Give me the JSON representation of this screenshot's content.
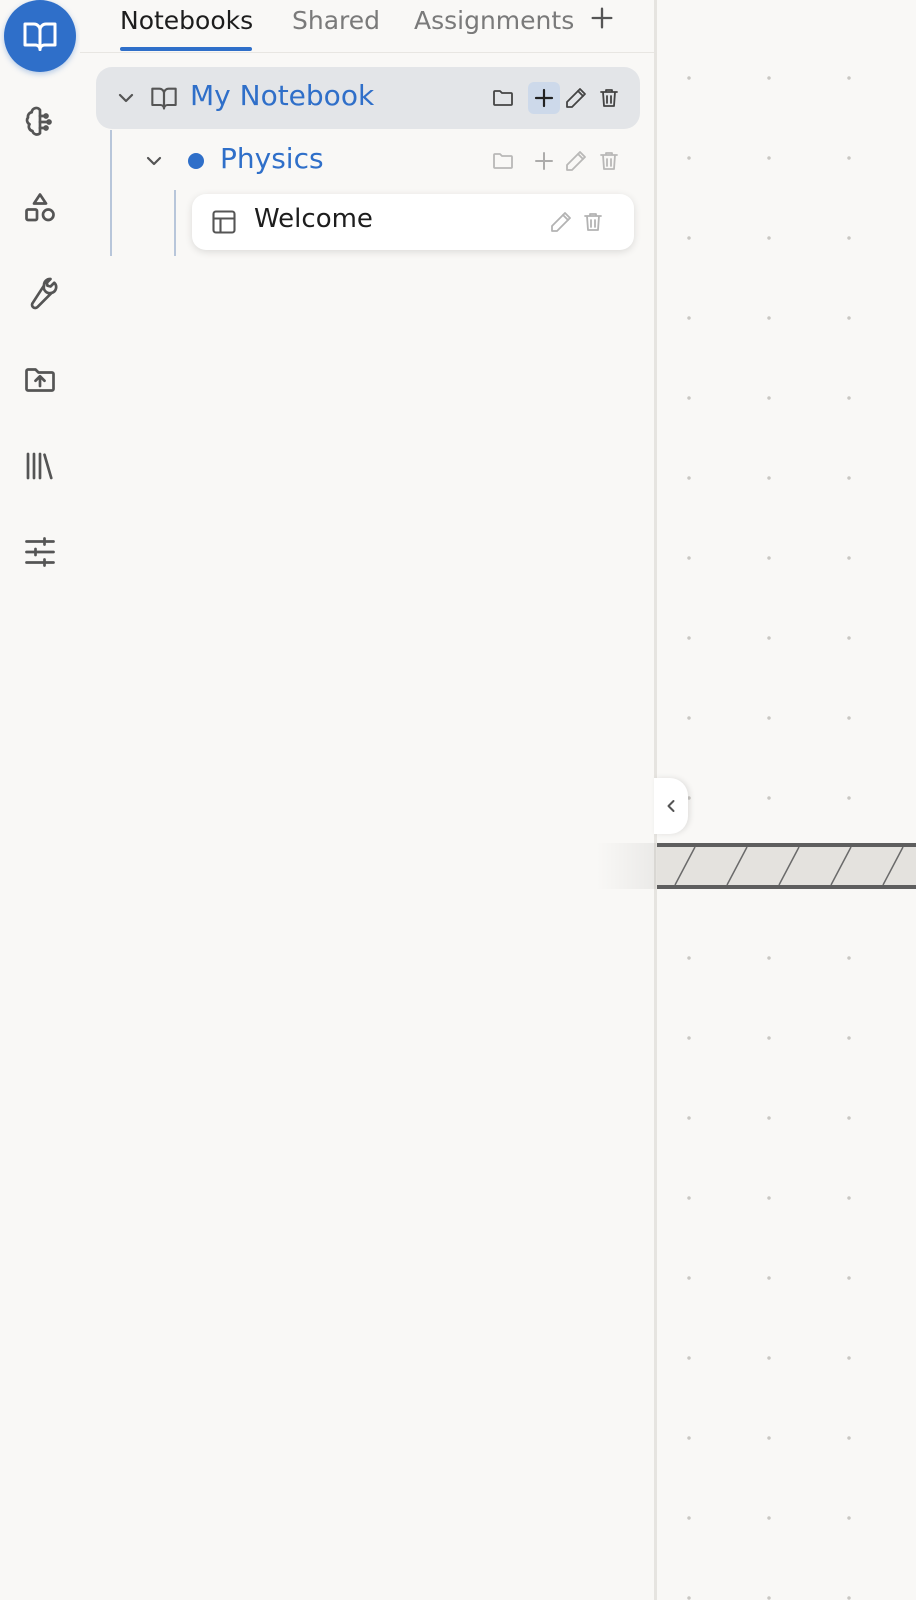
{
  "tabs": {
    "notebooks": "Notebooks",
    "shared": "Shared",
    "assignments": "Assignments"
  },
  "tree": {
    "notebook_label": "My Notebook",
    "section_label": "Physics",
    "page_label": "Welcome"
  },
  "rail_icons": [
    "notebook-icon",
    "brain-icon",
    "shapes-icon",
    "wrench-icon",
    "folder-upload-icon",
    "library-icon",
    "sliders-icon"
  ],
  "colors": {
    "accent": "#2f6fc9",
    "background": "#f9f8f6",
    "selected_row": "#e3e5e8"
  }
}
